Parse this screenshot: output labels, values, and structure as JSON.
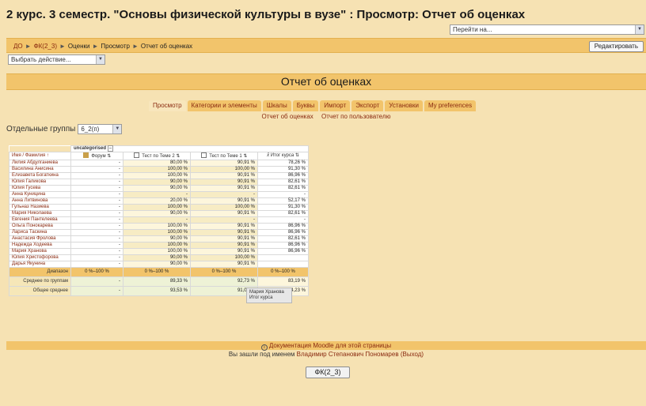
{
  "title": "2 курс. 3 семестр. \"Основы физической культуры в вузе\" : Просмотр: Отчет об оценках",
  "jump_to": {
    "value": "Перейти на..."
  },
  "breadcrumb": {
    "items": [
      "ДО",
      "ФК(2_3)",
      "Оценки",
      "Просмотр",
      "Отчет об оценках"
    ],
    "separator": "►"
  },
  "edit_button": "Редактировать",
  "action_select": "Выбрать действие...",
  "heading": "Отчет об оценках",
  "tabs": [
    {
      "label": "Просмотр",
      "active": true
    },
    {
      "label": "Категории и элементы",
      "active": false
    },
    {
      "label": "Шкалы",
      "active": false
    },
    {
      "label": "Буквы",
      "active": false
    },
    {
      "label": "Импорт",
      "active": false
    },
    {
      "label": "Экспорт",
      "active": false
    },
    {
      "label": "Установки",
      "active": false
    },
    {
      "label": "My preferences",
      "active": false
    }
  ],
  "subtabs": [
    "Отчет об оценках",
    "Отчет по пользователю"
  ],
  "groups": {
    "label": "Отдельные группы",
    "value": "6_2(п)"
  },
  "grade_table": {
    "category": "uncategorised",
    "category_toggle": "–",
    "columns": [
      "Имя / Фамилия",
      "Форум",
      "Тест по Теме 2",
      "Тест по Теме 1",
      "Итог курса"
    ],
    "rows": [
      [
        "Лилия Абдулганиева",
        "-",
        "80,00 %",
        "90,91 %",
        "78,26 %"
      ],
      [
        "Василина Анисина",
        "-",
        "100,00 %",
        "100,00 %",
        "91,30 %"
      ],
      [
        "Елизавета Богаткина",
        "-",
        "100,00 %",
        "90,91 %",
        "86,96 %"
      ],
      [
        "Юлия Галикова",
        "-",
        "90,00 %",
        "90,91 %",
        "82,61 %"
      ],
      [
        "Юлия Гусева",
        "-",
        "90,00 %",
        "90,91 %",
        "82,61 %"
      ],
      [
        "Анна Куницина",
        "-",
        "-",
        "-",
        "-"
      ],
      [
        "Анна Литвинова",
        "-",
        "20,00 %",
        "90,91 %",
        "52,17 %"
      ],
      [
        "Гульназ Назиева",
        "-",
        "100,00 %",
        "100,00 %",
        "91,30 %"
      ],
      [
        "Мария Николаева",
        "-",
        "90,00 %",
        "90,91 %",
        "82,61 %"
      ],
      [
        "Евгения Пантелеева",
        "-",
        "-",
        "-",
        "-"
      ],
      [
        "Ольга Понокарева",
        "-",
        "100,00 %",
        "90,91 %",
        "86,96 %"
      ],
      [
        "Лариса Таскина",
        "-",
        "100,00 %",
        "90,91 %",
        "86,96 %"
      ],
      [
        "Анастасия Фролова",
        "-",
        "90,00 %",
        "90,91 %",
        "82,61 %"
      ],
      [
        "Надежда Ходеева",
        "-",
        "100,00 %",
        "90,91 %",
        "86,96 %"
      ],
      [
        "Мария Хранова",
        "-",
        "100,00 %",
        "90,91 %",
        "86,96 %"
      ],
      [
        "Юлия Христофорова",
        "-",
        "90,00 %",
        "100,00 %",
        ""
      ],
      [
        "Дарья Якунина",
        "-",
        "90,00 %",
        "90,91 %",
        ""
      ]
    ],
    "range_row": [
      "Диапазон",
      "0 %–100 %",
      "0 %–100 %",
      "0 %–100 %",
      "0 %–100 %"
    ],
    "group_avg_row": [
      "Среднее по группам",
      "-",
      "89,33 %",
      "92,73 %",
      "83,19 %"
    ],
    "overall_avg_row": [
      "Общее среднее",
      "-",
      "93,53 %",
      "91,09 %",
      "84,23 %"
    ]
  },
  "tooltip": {
    "line1": "Мария Хранова",
    "line2": "Итог курса"
  },
  "footer": {
    "doc_link": "Документация Moodle для этой страницы",
    "login_prefix": "Вы зашли под именем",
    "user_name": "Владимир Степанович Пономарев",
    "logout": "(Выход)",
    "course_button": "ФК(2_3)"
  },
  "colors": {
    "band": "#f2c46b",
    "background": "#f6e2b3",
    "link": "#8a2a10"
  }
}
